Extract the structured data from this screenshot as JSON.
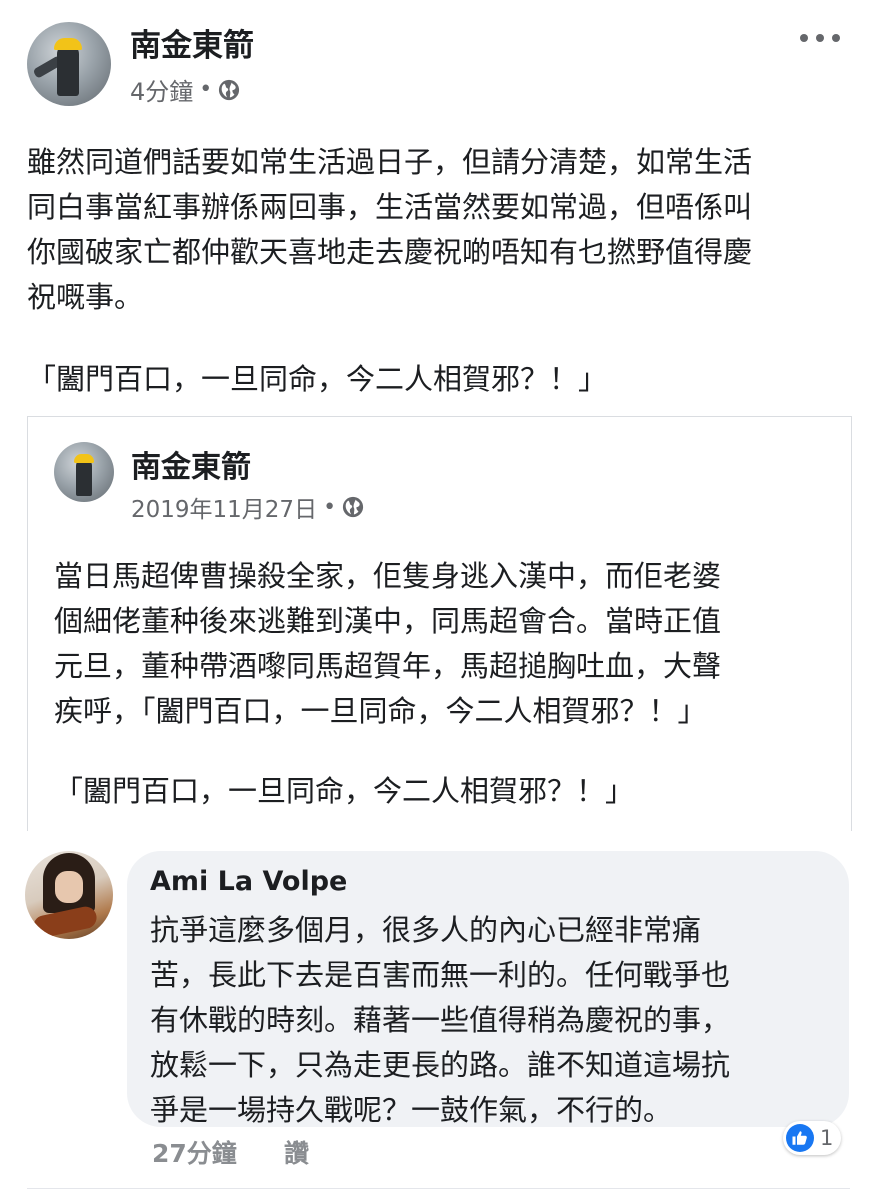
{
  "post": {
    "author": "南金東箭",
    "time": "4分鐘",
    "separator": "•",
    "privacy_icon": "globe-icon",
    "more_icon": "more-options-icon",
    "text": "雖然同道們話要如常生活過日子，但請分清楚，如常生活\n同白事當紅事辦係兩回事，生活當然要如常過，但唔係叫\n你國破家亡都仲歡天喜地走去慶祝啲唔知有乜撚野值得慶\n祝嘅事。",
    "quote": "「闔門百口，一旦同命，今二人相賀邪？！」"
  },
  "shared_post": {
    "author": "南金東箭",
    "date": "2019年11月27日",
    "separator": "•",
    "privacy_icon": "globe-icon",
    "text": "當日馬超俾曹操殺全家，佢隻身逃入漢中，而佢老婆\n個細佬董种後來逃難到漢中，同馬超會合。當時正值\n元旦，董种帶酒嚟同馬超賀年，馬超搥胸吐血，大聲\n疾呼，「闔門百口，一旦同命，今二人相賀邪？！」",
    "quote": "「闔門百口，一旦同命，今二人相賀邪？！」"
  },
  "comment": {
    "author": "Ami La Volpe",
    "text": "抗爭這麼多個月，很多人的內心已經非常痛\n苦，長此下去是百害而無一利的。任何戰爭也\n有休戰的時刻。藉著一些值得稍為慶祝的事，\n放鬆一下，只為走更長的路。誰不知道這場抗\n爭是一場持久戰呢？一鼓作氣，不行的。",
    "time": "27分鐘",
    "like_label": "讚",
    "reaction_icon": "like-icon",
    "reaction_count": "1"
  },
  "colors": {
    "text": "#1c1e21",
    "secondary": "#65676b",
    "bubble": "#f0f2f5",
    "like_blue": "#1877f2"
  }
}
